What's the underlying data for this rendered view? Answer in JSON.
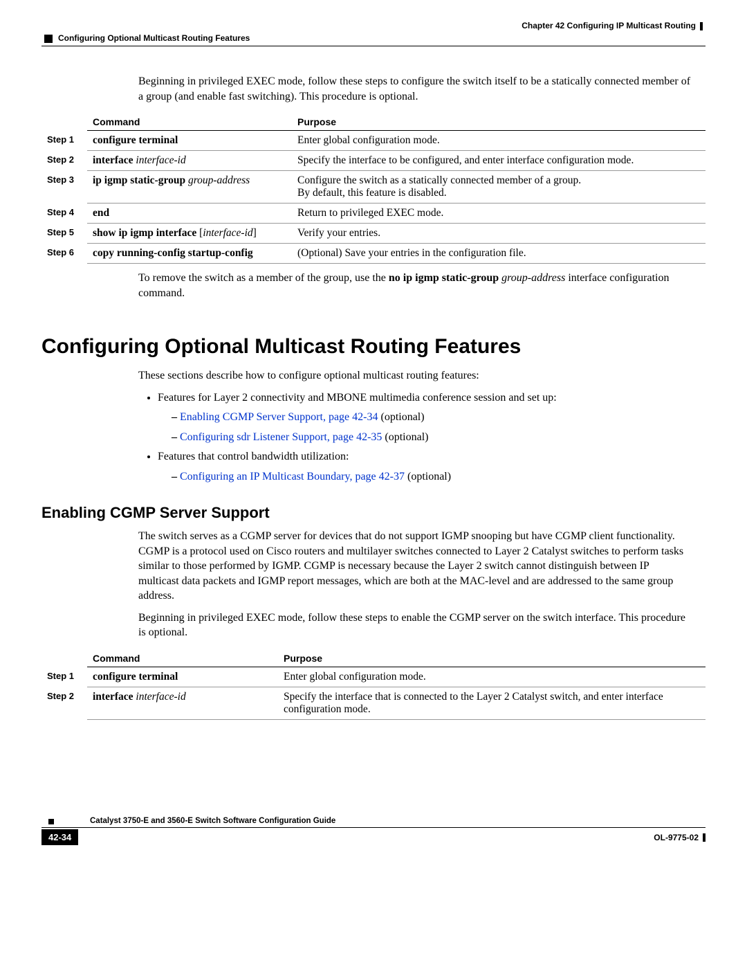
{
  "header": {
    "chapter": "Chapter 42    Configuring IP Multicast Routing",
    "section": "Configuring Optional Multicast Routing Features"
  },
  "intro1": "Beginning in privileged EXEC mode, follow these steps to configure the switch itself to be a statically connected member of a group (and enable fast switching). This procedure is optional.",
  "table1": {
    "h_command": "Command",
    "h_purpose": "Purpose",
    "rows": [
      {
        "step": "Step 1",
        "cmd_b": "configure terminal",
        "cmd_i": "",
        "purpose": "Enter global configuration mode."
      },
      {
        "step": "Step 2",
        "cmd_b": "interface",
        "cmd_i": " interface-id",
        "purpose": "Specify the interface to be configured, and enter interface configuration mode."
      },
      {
        "step": "Step 3",
        "cmd_b": "ip igmp static-group",
        "cmd_i": " group-address",
        "purpose": "Configure the switch as a statically connected member of a group.",
        "purpose2": "By default, this feature is disabled."
      },
      {
        "step": "Step 4",
        "cmd_b": "end",
        "cmd_i": "",
        "purpose": "Return to privileged EXEC mode."
      },
      {
        "step": "Step 5",
        "cmd_b": "show ip igmp interface",
        "cmd_bracket_i": "interface-id",
        "purpose": "Verify your entries."
      },
      {
        "step": "Step 6",
        "cmd_b": "copy running-config startup-config",
        "cmd_i": "",
        "purpose": "(Optional) Save your entries in the configuration file."
      }
    ]
  },
  "after1": {
    "prefix": "To remove the switch as a member of the group, use the ",
    "bold": "no ip igmp static-group",
    "italic": " group-address",
    "suffix": " interface configuration command."
  },
  "h1": "Configuring Optional Multicast Routing Features",
  "p2": "These sections describe how to configure optional multicast routing features:",
  "bullets": {
    "b1": "Features for Layer 2 connectivity and MBONE multimedia conference session and set up:",
    "b1a_link": "Enabling CGMP Server Support, page 42-34",
    "b1a_tail": " (optional)",
    "b1b_link": "Configuring sdr Listener Support, page 42-35",
    "b1b_tail": " (optional)",
    "b2": "Features that control bandwidth utilization:",
    "b2a_link": "Configuring an IP Multicast Boundary, page 42-37",
    "b2a_tail": " (optional)"
  },
  "h2": "Enabling CGMP Server Support",
  "p3": "The switch serves as a CGMP server for devices that do not support IGMP snooping but have CGMP client functionality. CGMP is a protocol used on Cisco routers and multilayer switches connected to Layer 2 Catalyst switches to perform tasks similar to those performed by IGMP. CGMP is necessary because the Layer 2 switch cannot distinguish between IP multicast data packets and IGMP report messages, which are both at the MAC-level and are addressed to the same group address.",
  "p4": "Beginning in privileged EXEC mode, follow these steps to enable the CGMP server on the switch interface. This procedure is optional.",
  "table2": {
    "h_command": "Command",
    "h_purpose": "Purpose",
    "rows": [
      {
        "step": "Step 1",
        "cmd_b": "configure terminal",
        "cmd_i": "",
        "purpose": "Enter global configuration mode."
      },
      {
        "step": "Step 2",
        "cmd_b": "interface",
        "cmd_i": " interface-id",
        "purpose": "Specify the interface that is connected to the Layer 2 Catalyst switch, and enter interface configuration mode."
      }
    ]
  },
  "footer": {
    "guide": "Catalyst 3750-E and 3560-E Switch Software Configuration Guide",
    "page": "42-34",
    "docid": "OL-9775-02"
  }
}
